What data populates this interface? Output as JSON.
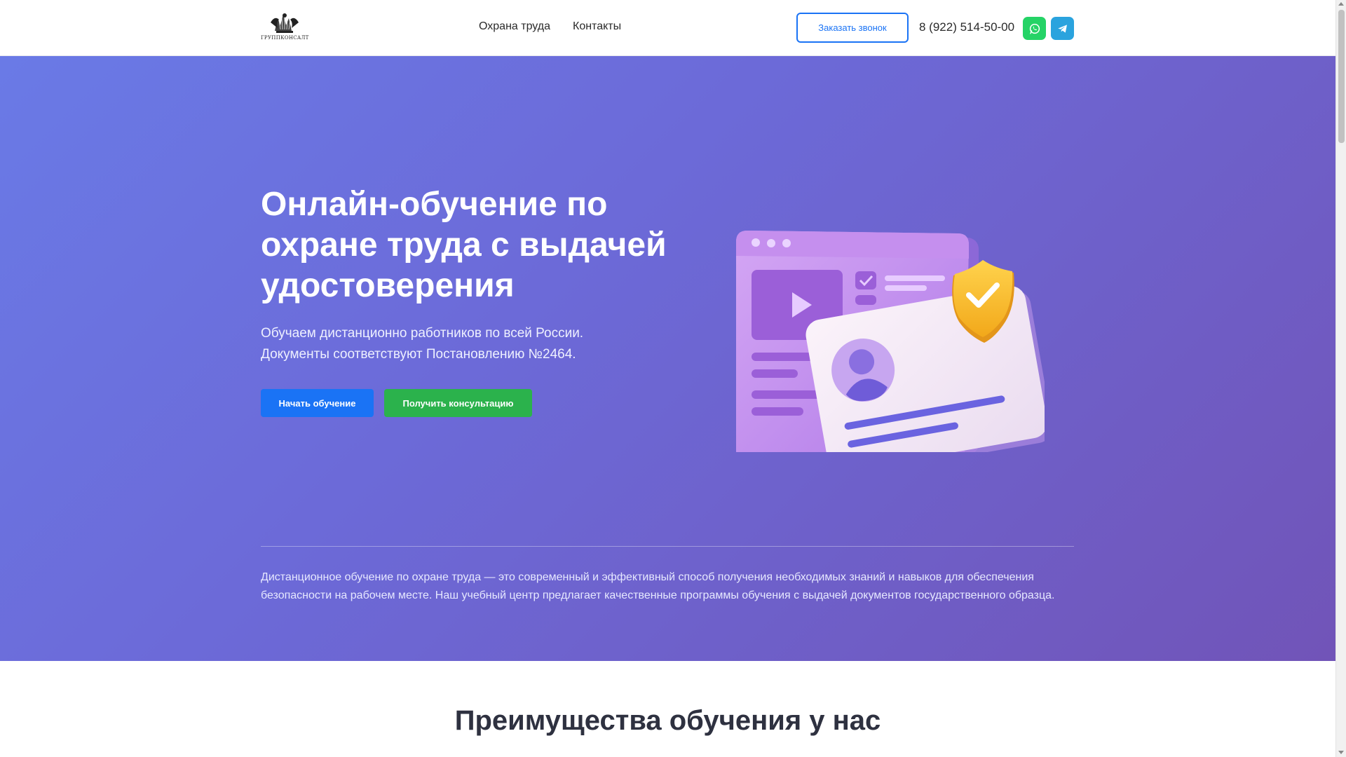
{
  "header": {
    "logo_text": "ГРУППКОНСАЛТ",
    "nav": [
      {
        "label": "Охрана труда"
      },
      {
        "label": "Контакты"
      }
    ],
    "callback_label": "Заказать звонок",
    "phone": "8 (922) 514-50-00",
    "whatsapp_icon": "whatsapp-icon",
    "telegram_icon": "telegram-icon"
  },
  "hero": {
    "title": "Онлайн-обучение по охране труда с выдачей удостоверения",
    "subtitle_line1": "Обучаем дистанционно работников по всей России.",
    "subtitle_line2": "Документы соответствуют Постановлению №2464.",
    "start_label": "Начать обучение",
    "consult_label": "Получить консультацию",
    "description": "Дистанционное обучение по охране труда — это современный и эффективный способ получения необходимых знаний и навыков для обеспечения безопасности на рабочем месте. Наш учебный центр предлагает качественные программы обучения с выдачей документов государственного образца."
  },
  "advantages": {
    "title": "Преимущества обучения у нас"
  },
  "colors": {
    "primary_blue": "#1a73f5",
    "green": "#2bb24c",
    "whatsapp": "#25d366",
    "telegram": "#2aa3de",
    "hero_gradient_start": "#6a7ae6",
    "hero_gradient_end": "#7154b8"
  }
}
